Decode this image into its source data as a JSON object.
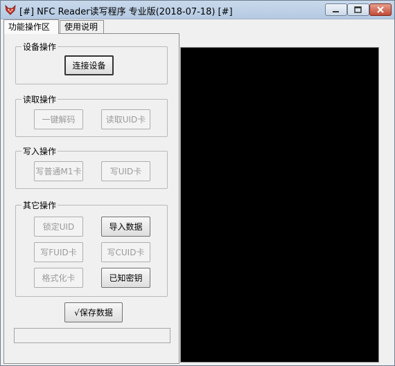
{
  "window": {
    "title": "[#] NFC Reader读写程序 专业版(2018-07-18) [#]"
  },
  "tabs": [
    {
      "label": "功能操作区",
      "active": true
    },
    {
      "label": "使用说明",
      "active": false
    }
  ],
  "groups": {
    "device": {
      "label": "设备操作",
      "connect": "连接设备"
    },
    "read": {
      "label": "读取操作",
      "decode": "一键解码",
      "read_uid": "读取UID卡"
    },
    "write": {
      "label": "写入操作",
      "write_m1": "写普通M1卡",
      "write_uid": "写UID卡"
    },
    "other": {
      "label": "其它操作",
      "lock_uid": "锁定UID",
      "import_data": "导入数据",
      "write_fuid": "写FUID卡",
      "write_cuid": "写CUID卡",
      "format_card": "格式化卡",
      "known_key": "已知密钥"
    }
  },
  "save_button": "√保存数据",
  "status_text": "",
  "output_text": "",
  "colors": {
    "output_background": "#000000",
    "window_background": "#f0f0f0"
  },
  "icons": {
    "app": "fox-icon",
    "minimize": "minimize-icon",
    "maximize": "maximize-icon",
    "close": "close-icon"
  }
}
